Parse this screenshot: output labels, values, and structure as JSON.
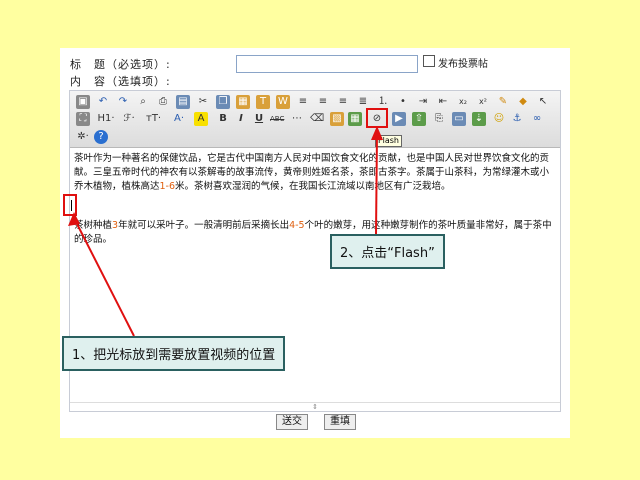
{
  "form": {
    "title_label": "标　题（必选项）:",
    "content_label": "内　容（选填项）:",
    "title_value": "",
    "poll_checkbox_label": "发布投票帖"
  },
  "toolbar": {
    "flash_tooltip": "Flash",
    "heading_label": "H1·"
  },
  "editor": {
    "para1_a": "茶叶作为一种著名的保健饮品，它是古代中国南方人民对中国饮食文化的贡献，也是中国人民对世界饮食文化的贡献。三皇五帝时代的神农有以茶解毒的故事流传，黄帝则姓姬名茶，茶即古茶字。茶属于山茶科，为常绿灌木或小乔木植物，植株高达",
    "para1_hl": "1-6",
    "para1_b": "米。茶树喜欢湿润的气候，在我国长江流域以南地区有广泛栽培。",
    "para2_a": "茶树种植",
    "para2_hl1": "3",
    "para2_b": "年就可以采叶子。一般清明前后采摘长出",
    "para2_hl2": "4-5",
    "para2_c": "个叶的嫩芽，用这种嫩芽制作的茶叶质量非常好，属于茶中的珍品。"
  },
  "buttons": {
    "submit": "送交",
    "reset": "重填"
  },
  "callouts": {
    "step1": "1、把光标放到需要放置视频的位置",
    "step2": "2、点击“Flash”"
  },
  "colors": {
    "background": "#FFFFA0",
    "highlight_red": "#E01010",
    "callout_fill": "#DFF0EE"
  }
}
